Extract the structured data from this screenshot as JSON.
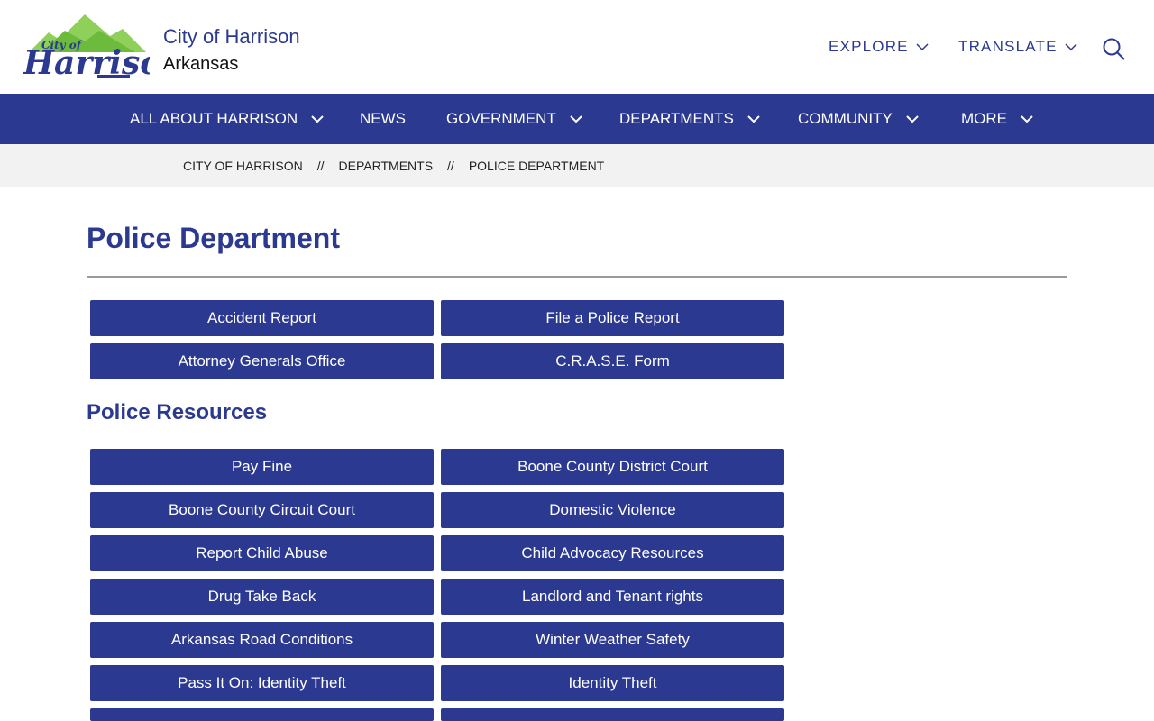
{
  "header": {
    "city": "City of Harrison",
    "state": "Arkansas",
    "explore": "EXPLORE",
    "translate": "TRANSLATE",
    "logo": {
      "script_text": "Harrison",
      "small_text": "City of",
      "colors": {
        "mountain": "#6cbb3c",
        "mountain_light": "#8fd05a",
        "script": "#2b3990"
      }
    }
  },
  "nav": {
    "items": [
      {
        "label": "ALL ABOUT HARRISON",
        "has_menu": true
      },
      {
        "label": "NEWS",
        "has_menu": false
      },
      {
        "label": "GOVERNMENT",
        "has_menu": true
      },
      {
        "label": "DEPARTMENTS",
        "has_menu": true
      },
      {
        "label": "COMMUNITY",
        "has_menu": true
      },
      {
        "label": "MORE",
        "has_menu": true
      }
    ]
  },
  "breadcrumb": {
    "items": [
      "CITY OF HARRISON",
      "DEPARTMENTS",
      "POLICE DEPARTMENT"
    ],
    "separator": "//"
  },
  "page": {
    "title": "Police Department",
    "quick_links": [
      "Accident Report",
      "File a Police Report",
      "Attorney Generals Office",
      "C.R.A.S.E. Form"
    ],
    "resources_title": "Police Resources",
    "resources": [
      "Pay Fine",
      "Boone County District Court",
      "Boone County Circuit Court",
      "Domestic Violence",
      "Report Child Abuse",
      "Child Advocacy Resources",
      "Drug Take Back",
      "Landlord and Tenant rights",
      "Arkansas Road Conditions",
      "Winter Weather Safety",
      "Pass It On: Identity Theft",
      "Identity Theft"
    ]
  },
  "colors": {
    "primary": "#2b3990",
    "crumb_bg": "#f2f2f2",
    "rule": "#9a9a9a"
  },
  "icons": {
    "search": "search-icon",
    "chevron": "chevron-down-icon"
  }
}
